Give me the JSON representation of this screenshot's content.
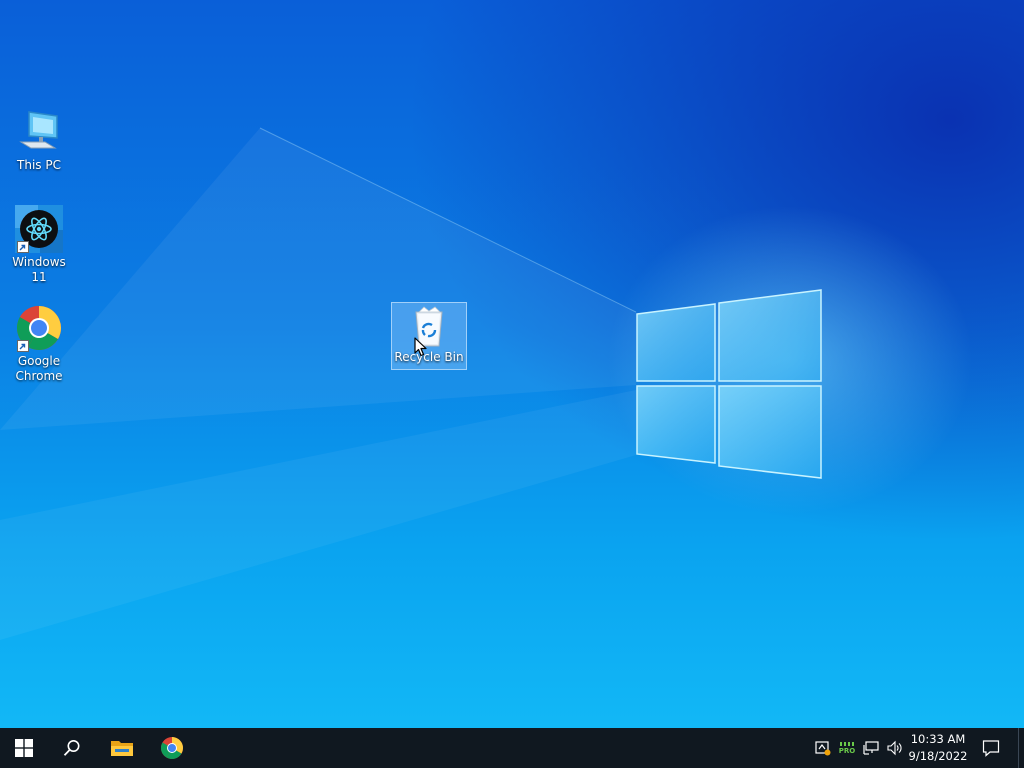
{
  "desktop": {
    "icons": [
      {
        "label": "This PC",
        "icon": "this-pc-icon"
      },
      {
        "label": "Windows 11",
        "icon": "windows-11-react-icon",
        "shortcut": true
      },
      {
        "label": "Google Chrome",
        "label_line1": "Google",
        "label_line2": "Chrome",
        "icon": "chrome-icon",
        "shortcut": true
      },
      {
        "label": "Recycle Bin",
        "icon": "recycle-bin-icon",
        "selected": true
      }
    ]
  },
  "taskbar": {
    "start": "windows-start-icon",
    "search": "search-icon",
    "pinned": [
      "file-explorer-icon",
      "chrome-icon"
    ],
    "tray": [
      "defender-icon",
      "pro-battery-icon",
      "network-icon",
      "volume-icon"
    ],
    "tray_badge": "PRO",
    "clock": {
      "time": "10:33 AM",
      "date": "9/18/2022"
    },
    "notification": "action-center-icon"
  },
  "colors": {
    "taskbar": "#101820",
    "accent": "#0a78d7"
  }
}
